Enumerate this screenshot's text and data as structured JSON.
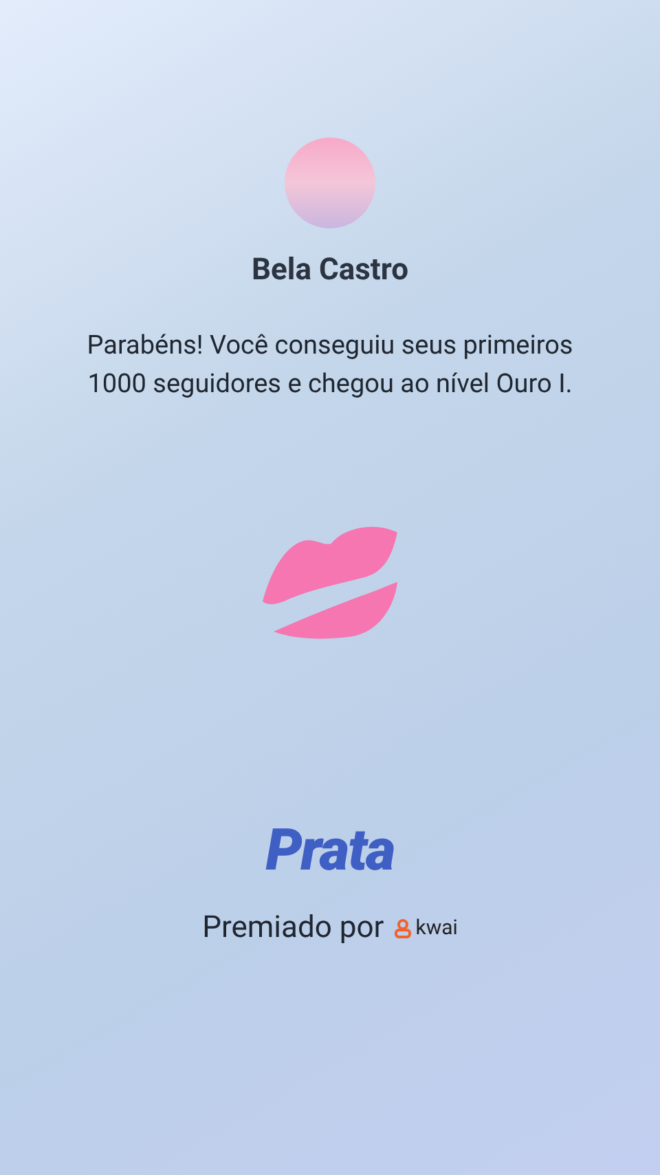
{
  "user": {
    "name": "Bela Castro"
  },
  "message": "Parabéns! Você conseguiu seus primeiros 1000 seguidores e chegou ao nível Ouro I.",
  "level_title": "Prata",
  "awarded_by": {
    "label": "Premiado por",
    "brand": "kwai"
  }
}
